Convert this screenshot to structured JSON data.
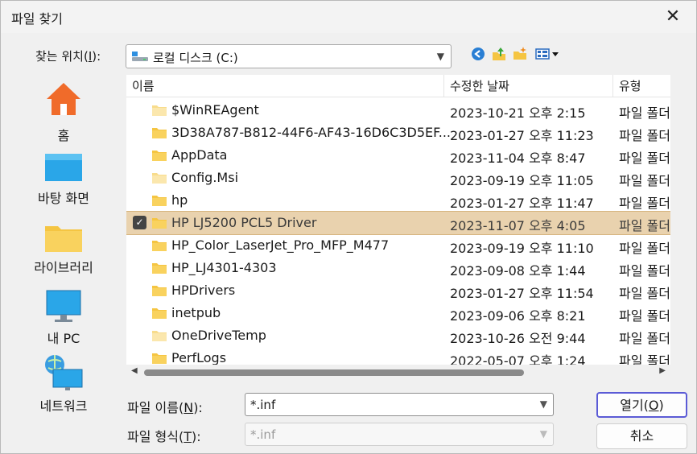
{
  "window": {
    "title": "파일 찾기"
  },
  "lookin": {
    "label_pre": "찾는 위치(",
    "label_key": "I",
    "label_post": "):",
    "value": "로컬 디스크 (C:)"
  },
  "toolbar": {
    "icons": [
      "back-icon",
      "up-folder-icon",
      "new-folder-icon",
      "view-menu-icon"
    ]
  },
  "places": [
    {
      "label": "홈",
      "icon": "home-icon"
    },
    {
      "label": "바탕 화면",
      "icon": "desktop-icon"
    },
    {
      "label": "라이브러리",
      "icon": "library-icon"
    },
    {
      "label": "내 PC",
      "icon": "pc-icon"
    },
    {
      "label": "네트워크",
      "icon": "network-icon"
    }
  ],
  "columns": {
    "name": "이름",
    "date": "수정한 날짜",
    "type": "유형"
  },
  "files": [
    {
      "name": "$WinREAgent",
      "date": "2023-10-21 오후 2:15",
      "type": "파일 폴더",
      "selected": false,
      "faded": true
    },
    {
      "name": "3D38A787-B812-44F6-AF43-16D6C3D5EF...",
      "date": "2023-01-27 오후 11:23",
      "type": "파일 폴더",
      "selected": false,
      "faded": false
    },
    {
      "name": "AppData",
      "date": "2023-11-04 오후 8:47",
      "type": "파일 폴더",
      "selected": false,
      "faded": false
    },
    {
      "name": "Config.Msi",
      "date": "2023-09-19 오후 11:05",
      "type": "파일 폴더",
      "selected": false,
      "faded": true
    },
    {
      "name": "hp",
      "date": "2023-01-27 오후 11:47",
      "type": "파일 폴더",
      "selected": false,
      "faded": false
    },
    {
      "name": "HP LJ5200 PCL5 Driver",
      "date": "2023-11-07 오후 4:05",
      "type": "파일 폴더",
      "selected": true,
      "faded": false
    },
    {
      "name": "HP_Color_LaserJet_Pro_MFP_M477",
      "date": "2023-09-19 오후 11:10",
      "type": "파일 폴더",
      "selected": false,
      "faded": false
    },
    {
      "name": "HP_LJ4301-4303",
      "date": "2023-09-08 오후 1:44",
      "type": "파일 폴더",
      "selected": false,
      "faded": false
    },
    {
      "name": "HPDrivers",
      "date": "2023-01-27 오후 11:54",
      "type": "파일 폴더",
      "selected": false,
      "faded": false
    },
    {
      "name": "inetpub",
      "date": "2023-09-06 오후 8:21",
      "type": "파일 폴더",
      "selected": false,
      "faded": false
    },
    {
      "name": "OneDriveTemp",
      "date": "2023-10-26 오전 9:44",
      "type": "파일 폴더",
      "selected": false,
      "faded": true
    },
    {
      "name": "PerfLogs",
      "date": "2022-05-07 오후 1:24",
      "type": "파일 폴더",
      "selected": false,
      "faded": false
    }
  ],
  "filename": {
    "label_pre": "파일 이름(",
    "label_key": "N",
    "label_post": "):",
    "value": "*.inf"
  },
  "filetype": {
    "label_pre": "파일 형식(",
    "label_key": "T",
    "label_post": "):",
    "value": "*.inf"
  },
  "buttons": {
    "open_pre": "열기(",
    "open_key": "O",
    "open_post": ")",
    "cancel": "취소"
  },
  "colors": {
    "selection": "#e9d2ae",
    "folder": "#f5c542",
    "folder_faded": "#f8dc8c",
    "default_button_border": "#5b5bd6"
  }
}
